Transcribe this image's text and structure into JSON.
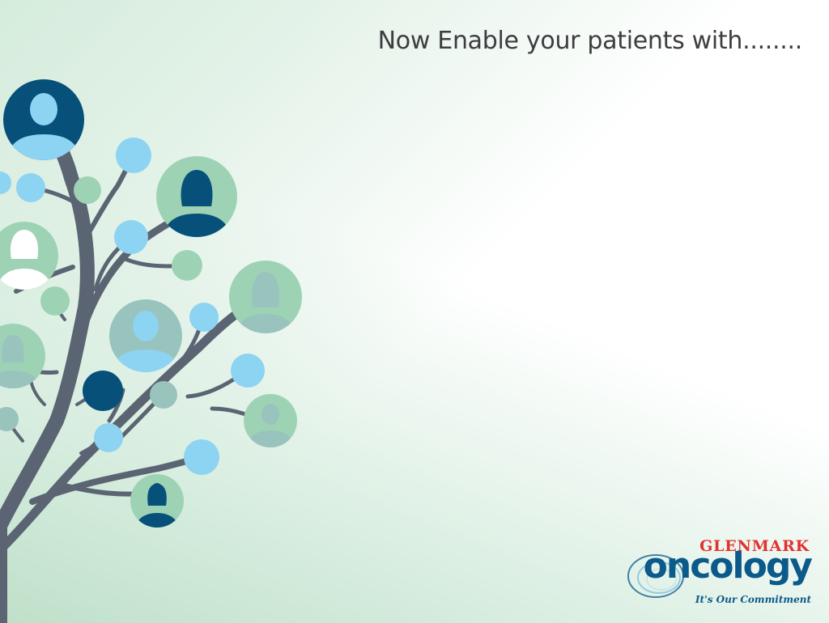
{
  "headline": "Now Enable your patients with........",
  "logo": {
    "brand": "GLENMARK",
    "name": "oncology",
    "tagline": "It's Our Commitment"
  },
  "colors": {
    "branch": "#5b6472",
    "dark_blue": "#06507a",
    "light_blue": "#8dd3f2",
    "light_green": "#9dd3b4",
    "sage": "#99c4bd",
    "brand_red": "#e2322e",
    "brand_blue": "#0b5a8a"
  },
  "icons": [
    "person-avatar-icon",
    "circle-bubble-icon",
    "swirl-logo-icon"
  ]
}
